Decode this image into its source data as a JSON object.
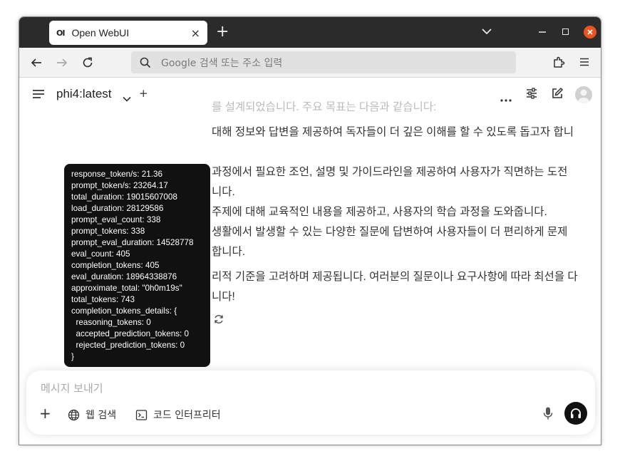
{
  "browser": {
    "tab_favicon": "OI",
    "tab_title": "Open WebUI",
    "tab_close": "×",
    "new_tab": "+",
    "url_placeholder": "Google 검색 또는 주소 입력"
  },
  "header": {
    "model_name": "phi4:latest",
    "add_model": "+"
  },
  "message": {
    "lines": [
      "를 설계되었습니다. 주요 목표는 다음과 같습니다:",
      "대해 정보와 답변을 제공하여 독자들이 더 깊은 이해를 할 수 있도록 돕고자 합니",
      "",
      "과정에서 필요한 조언, 설명 및 가이드라인을 제공하여 사용자가 직면하는 도전",
      "니다.",
      "주제에 대해 교육적인 내용을 제공하고, 사용자의 학습 과정을 도와줍니다.",
      "생활에서 발생할 수 있는 다양한 질문에 답변하여 사용자들이 더 편리하게 문제",
      "합니다.",
      "리적 기준을 고려하며 제공됩니다. 여러분의 질문이나 요구사항에 따라 최선을 다",
      "니다!"
    ]
  },
  "tooltip": {
    "lines": [
      "response_token/s: 21.36",
      "prompt_token/s: 23264.17",
      "total_duration: 19015607008",
      "load_duration: 28129586",
      "prompt_eval_count: 338",
      "prompt_tokens: 338",
      "prompt_eval_duration: 14528778",
      "eval_count: 405",
      "completion_tokens: 405",
      "eval_duration: 18964338876",
      "approximate_total: \"0h0m19s\"",
      "total_tokens: 743",
      "completion_tokens_details: {",
      "  reasoning_tokens: 0",
      "  accepted_prediction_tokens: 0",
      "  rejected_prediction_tokens: 0",
      "}"
    ]
  },
  "composer": {
    "placeholder": "메시지 보내기",
    "plus": "+",
    "web_search": "웹 검색",
    "code_interpreter": "코드 인터프리터"
  }
}
